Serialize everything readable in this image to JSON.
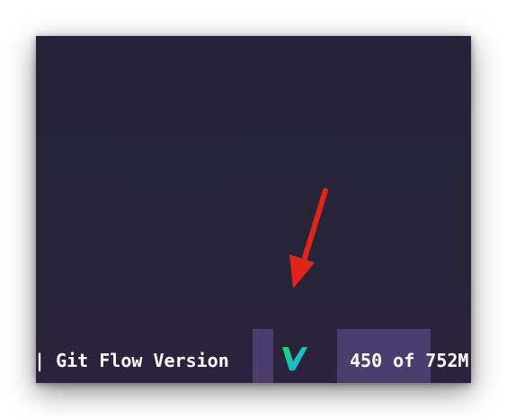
{
  "statusbar": {
    "git_flow_label": "| Git Flow Version",
    "position_text": "450 of 752M",
    "logo_icon": "v-logo-icon",
    "colors": {
      "block": "#4c3d6e",
      "logo_green": "#1ed760",
      "logo_blue": "#21a3f0"
    }
  },
  "annotation": {
    "arrow_icon": "red-arrow-icon",
    "arrow_color": "#e0241a"
  }
}
